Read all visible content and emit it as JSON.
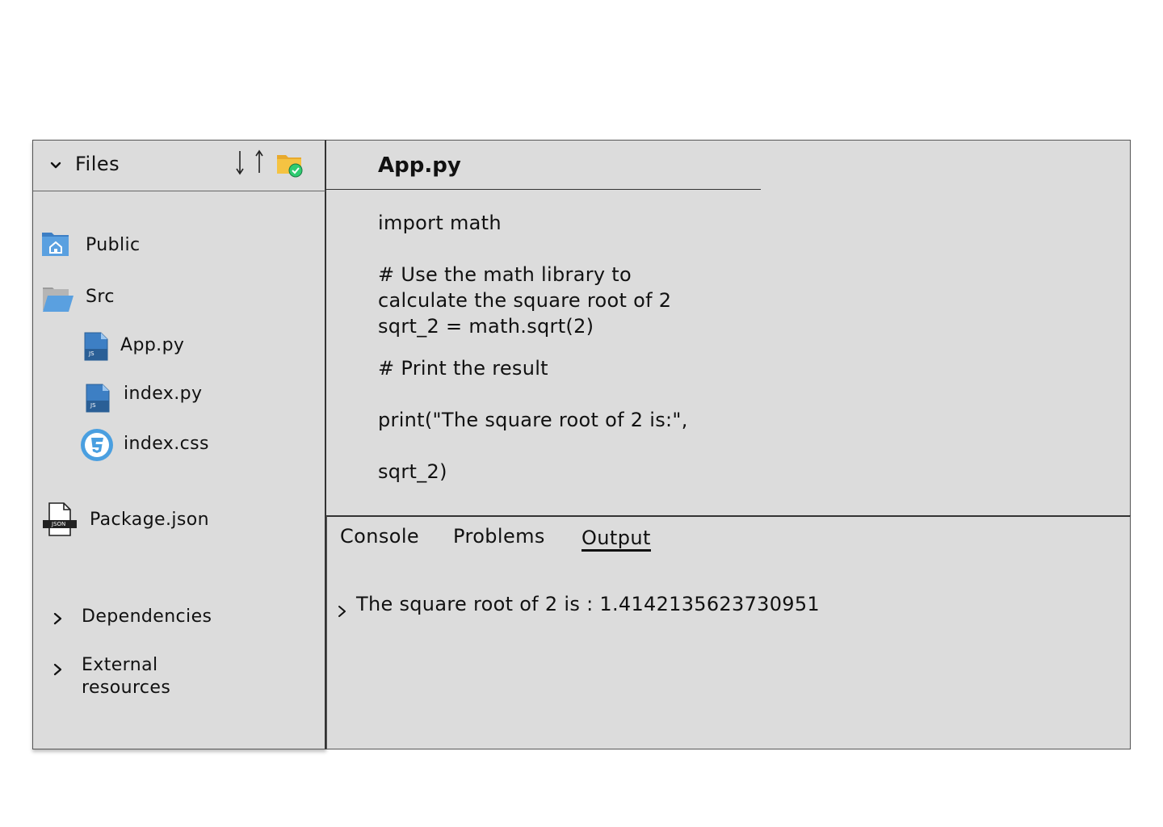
{
  "sidebar": {
    "title": "Files",
    "items": [
      {
        "label": "Public",
        "icon": "public-folder-icon"
      },
      {
        "label": "Src",
        "icon": "open-folder-icon"
      },
      {
        "label": "App.py",
        "icon": "js-file-icon",
        "badge": "JS"
      },
      {
        "label": "index.py",
        "icon": "js-file-icon",
        "badge": "JS"
      },
      {
        "label": "index.css",
        "icon": "css3-icon"
      },
      {
        "label": "Package.json",
        "icon": "json-file-icon",
        "badge": "JSON"
      }
    ],
    "groups": [
      {
        "label": "Dependencies"
      },
      {
        "label_line1": "External",
        "label_line2": "resources"
      }
    ]
  },
  "editor": {
    "file_name": "App.py",
    "lines": [
      "import math",
      "",
      "# Use the math library to",
      "calculate the square root of 2",
      "sqrt_2 = math.sqrt(2)",
      "",
      "# Print the result",
      "",
      "print(\"The square root of 2 is:\",",
      "",
      "sqrt_2)"
    ]
  },
  "bottom_panel": {
    "tabs": [
      "Console",
      "Problems",
      "Output"
    ],
    "active_tab": "Output",
    "output": "The square root of 2 is : 1.4142135623730951"
  },
  "colors": {
    "panel_bg": "#dcdcdc",
    "folder_blue": "#5aa0e0",
    "css_blue": "#4a9fe0",
    "folder_yellow": "#f5c342",
    "check_green": "#2ecc71"
  }
}
